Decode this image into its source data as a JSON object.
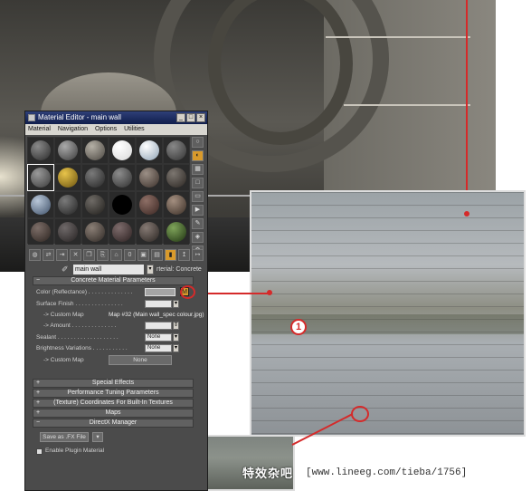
{
  "window": {
    "title": "Material Editor - main wall",
    "min": "_",
    "max": "□",
    "close": "×"
  },
  "menu": [
    "Material",
    "Navigation",
    "Options",
    "Utilities"
  ],
  "material_selector": {
    "name": "main wall",
    "type": "rterial: Concrete"
  },
  "rollout_main": {
    "header": "Concrete Material Parameters",
    "rows": {
      "color": "Color (Reflectance) . . . . . . . . . . . . . .",
      "map_button": "M",
      "surface_finish": "Surface Finish . . . . . . . . . . . . . . .",
      "custom_map": "-> Custom Map",
      "custom_map_value": "Map #32 (Main wall_spec colour.jpg)",
      "amount": "-> Amount . . . . . . . . . . . . . .",
      "sealant": "Sealant . . . . . . . . . . . . . . . . . . .",
      "sealant_value": "None",
      "brightness": "Brightness Variations . . . . . . . . . . .",
      "brightness_value": "None",
      "custom_map2": "-> Custom Map",
      "custom_map2_value": "None"
    }
  },
  "rollouts": [
    "Special Effects",
    "Performance Tuning Parameters",
    "(Texture) Coordinates For Built-In Textures",
    "Maps",
    "DirectX Manager"
  ],
  "directx": {
    "save_button": "Save as .FX File",
    "enable_plugin": "Enable Plugin Material"
  },
  "annotations": {
    "marker_1": "1"
  },
  "watermark": {
    "cn": "特效杂吧",
    "url": "[www.lineeg.com/tieba/1756]"
  }
}
